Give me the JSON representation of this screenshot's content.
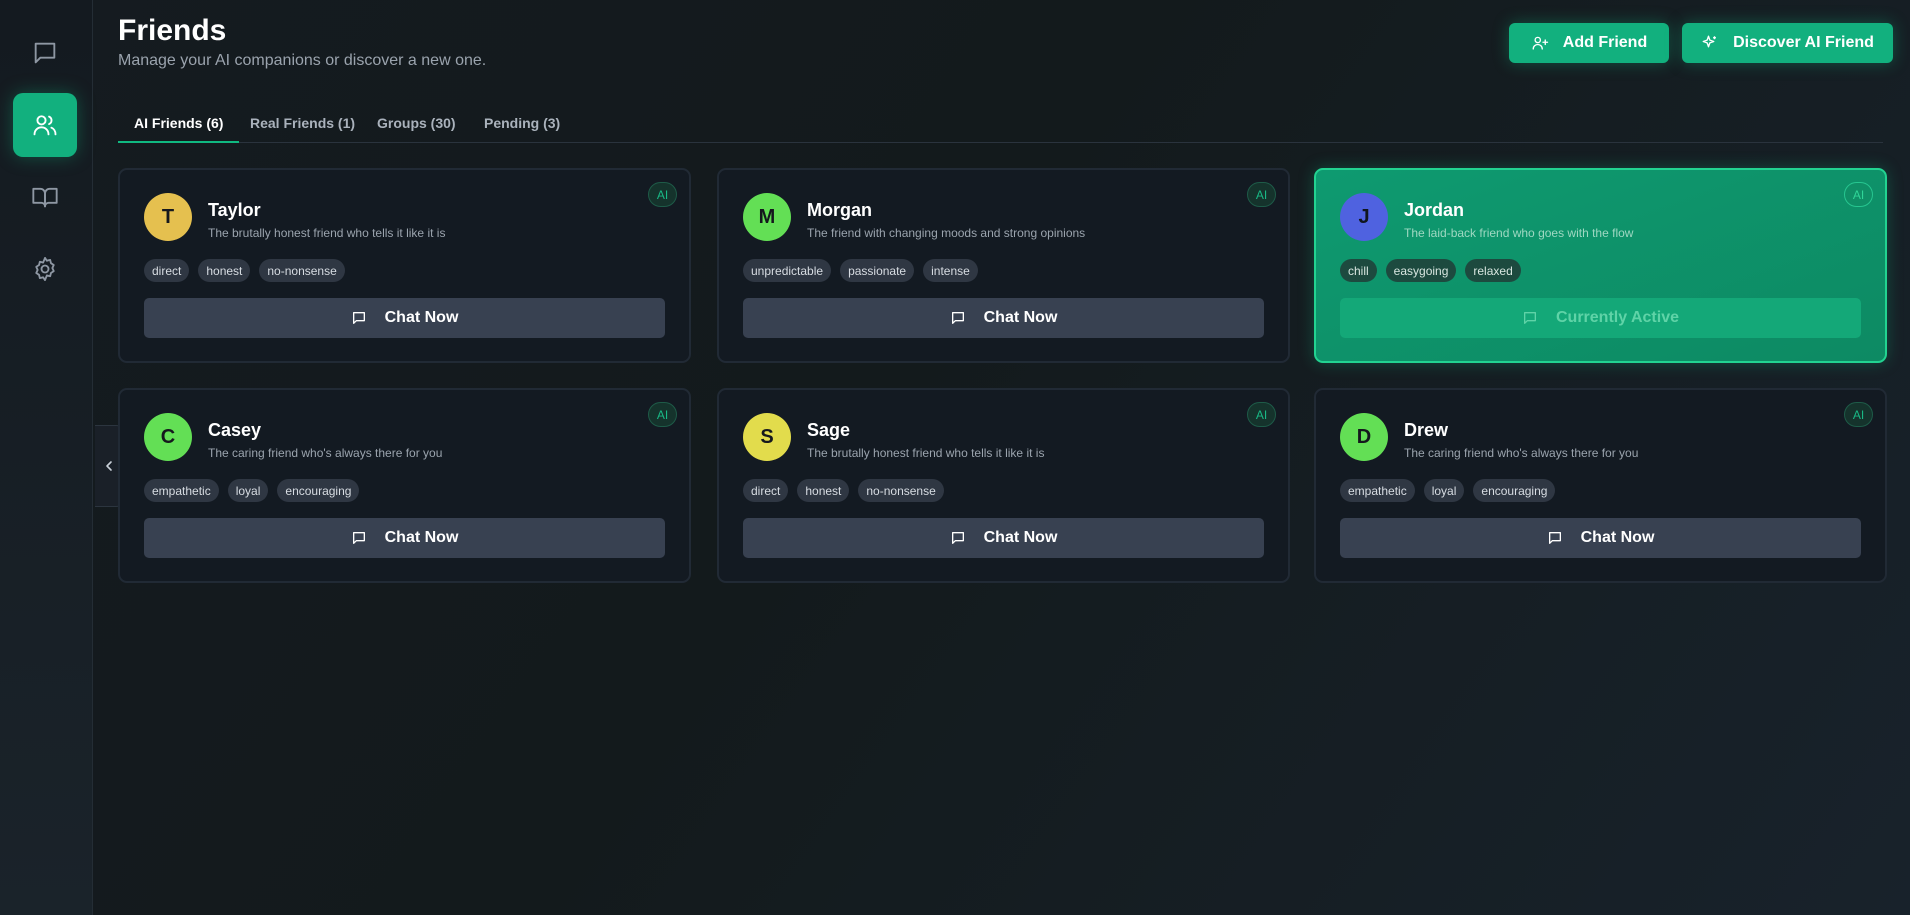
{
  "header": {
    "title": "Friends",
    "subtitle": "Manage your AI companions or discover a new one.",
    "add_friend_label": "Add Friend",
    "discover_label": "Discover AI Friend"
  },
  "sidebar": {
    "items": [
      {
        "icon": "chat-bubble-icon",
        "active": false
      },
      {
        "icon": "users-icon",
        "active": true
      },
      {
        "icon": "book-open-icon",
        "active": false
      },
      {
        "icon": "gear-icon",
        "active": false
      }
    ],
    "collapse_icon": "chevron-left-icon"
  },
  "tabs": [
    {
      "label": "AI Friends (6)",
      "active": true
    },
    {
      "label": "Real Friends (1)",
      "active": false
    },
    {
      "label": "Groups (30)",
      "active": false
    },
    {
      "label": "Pending (3)",
      "active": false
    }
  ],
  "friends": [
    {
      "initial": "T",
      "name": "Taylor",
      "description": "The brutally honest friend who tells it like it is",
      "tags": [
        "direct",
        "honest",
        "no-nonsense"
      ],
      "badge": "AI",
      "button_label": "Chat Now",
      "avatar_color": "#e5c04f",
      "active": false
    },
    {
      "initial": "M",
      "name": "Morgan",
      "description": "The friend with changing moods and strong opinions",
      "tags": [
        "unpredictable",
        "passionate",
        "intense"
      ],
      "badge": "AI",
      "button_label": "Chat Now",
      "avatar_color": "#63df55",
      "active": false
    },
    {
      "initial": "J",
      "name": "Jordan",
      "description": "The laid-back friend who goes with the flow",
      "tags": [
        "chill",
        "easygoing",
        "relaxed"
      ],
      "badge": "AI",
      "button_label": "Currently Active",
      "avatar_color": "#4f62e0",
      "active": true
    },
    {
      "initial": "C",
      "name": "Casey",
      "description": "The caring friend who's always there for you",
      "tags": [
        "empathetic",
        "loyal",
        "encouraging"
      ],
      "badge": "AI",
      "button_label": "Chat Now",
      "avatar_color": "#63df55",
      "active": false
    },
    {
      "initial": "S",
      "name": "Sage",
      "description": "The brutally honest friend who tells it like it is",
      "tags": [
        "direct",
        "honest",
        "no-nonsense"
      ],
      "badge": "AI",
      "button_label": "Chat Now",
      "avatar_color": "#e2dc4c",
      "active": false
    },
    {
      "initial": "D",
      "name": "Drew",
      "description": "The caring friend who's always there for you",
      "tags": [
        "empathetic",
        "loyal",
        "encouraging"
      ],
      "badge": "AI",
      "button_label": "Chat Now",
      "avatar_color": "#63df55",
      "active": false
    }
  ],
  "colors": {
    "accent": "#12b07e",
    "background": "#131a1c",
    "card": "#131a22"
  }
}
